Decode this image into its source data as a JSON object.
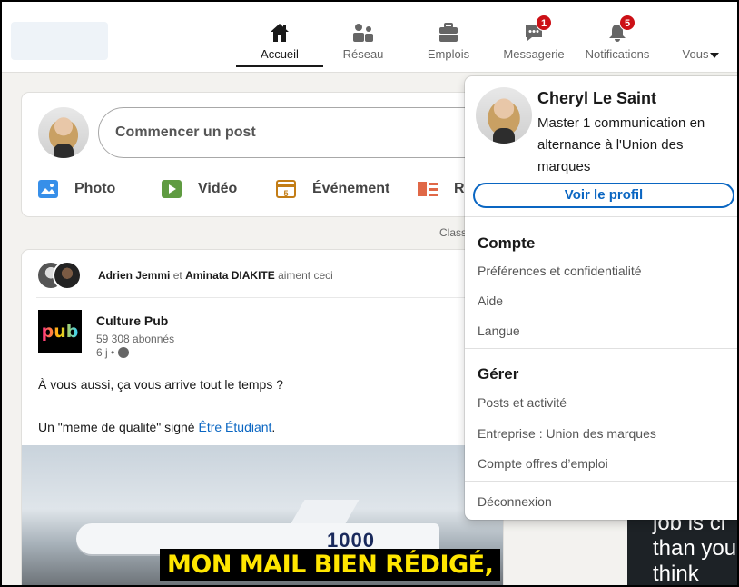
{
  "nav": {
    "items": [
      {
        "key": "home",
        "label": "Accueil",
        "icon": "home-icon",
        "active": true
      },
      {
        "key": "network",
        "label": "Réseau",
        "icon": "network-icon"
      },
      {
        "key": "jobs",
        "label": "Emplois",
        "icon": "briefcase-icon"
      },
      {
        "key": "messaging",
        "label": "Messagerie",
        "icon": "chat-icon",
        "badge": "1"
      },
      {
        "key": "notifications",
        "label": "Notifications",
        "icon": "bell-icon",
        "badge": "5"
      },
      {
        "key": "me",
        "label": "Vous",
        "icon": "avatar"
      }
    ]
  },
  "share": {
    "placeholder": "Commencer un post",
    "actions": [
      {
        "label": "Photo",
        "icon": "photo-icon",
        "color": "#378fe9"
      },
      {
        "label": "Vidéo",
        "icon": "video-icon",
        "color": "#5f9b41"
      },
      {
        "label": "Événement",
        "icon": "calendar-icon",
        "color": "#c37d16"
      },
      {
        "label": "R",
        "icon": "article-icon",
        "color": "#e06847"
      }
    ]
  },
  "feed": {
    "sort_text": "Class",
    "social": {
      "person1": "Adrien Jemmi",
      "connector": "et",
      "person2": "Aminata DIAKITE",
      "action": "aiment ceci"
    },
    "post": {
      "author": "Culture Pub",
      "followers": "59 308 abonnés",
      "time": "6 j •",
      "logo_text": "pub",
      "text1": "À vous aussi, ça vous arrive tout le temps ?",
      "text2_prefix": "Un \"meme de qualité\" signé ",
      "text2_link": "Être Étudiant",
      "text2_suffix": ".",
      "image_number": "1000",
      "image_caption": "MON MAIL BIEN RÉDIGÉ,"
    }
  },
  "right_card": {
    "text": "job is cl\nthan you\nthink"
  },
  "profile_menu": {
    "name": "Cheryl Le Saint",
    "headline": "Master 1 communication en alternance à l'Union des marques",
    "view_profile": "Voir le profil",
    "sections": [
      {
        "title": "Compte",
        "items": [
          "Préférences et confidentialité",
          "Aide",
          "Langue"
        ]
      },
      {
        "title": "Gérer",
        "items": [
          "Posts et activité",
          "Entreprise : Union des marques",
          "Compte offres d’emploi"
        ]
      }
    ],
    "logout": "Déconnexion"
  },
  "colors": {
    "accent": "#0a66c2",
    "badge": "#cc1016",
    "background": "#f3f2ef"
  }
}
